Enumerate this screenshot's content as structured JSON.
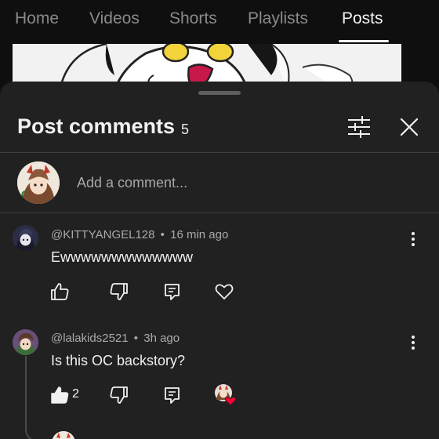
{
  "tabs": [
    {
      "label": "Home",
      "active": false
    },
    {
      "label": "Videos",
      "active": false
    },
    {
      "label": "Shorts",
      "active": false
    },
    {
      "label": "Playlists",
      "active": false
    },
    {
      "label": "Posts",
      "active": true
    }
  ],
  "sheet": {
    "title": "Post comments",
    "count": "5",
    "add_comment_placeholder": "Add a comment..."
  },
  "comments": [
    {
      "author": "@KITTYANGEL128",
      "separator": "•",
      "time": "16 min ago",
      "text": "Ewwwwwwwwwwwww",
      "likes": "",
      "creator_hearted": false
    },
    {
      "author": "@lalakids2521",
      "separator": "•",
      "time": "3h ago",
      "text": "Is this OC backstory?",
      "likes": "2",
      "creator_hearted": true
    }
  ],
  "icons": {
    "filter": "sliders-icon",
    "close": "close-icon",
    "like": "thumbs-up-icon",
    "dislike": "thumbs-down-icon",
    "reply": "reply-icon",
    "heart": "heart-icon",
    "more": "kebab-menu-icon"
  },
  "colors": {
    "background": "#0f0f0f",
    "sheet": "#212121",
    "heart_badge": "#ff0033"
  }
}
